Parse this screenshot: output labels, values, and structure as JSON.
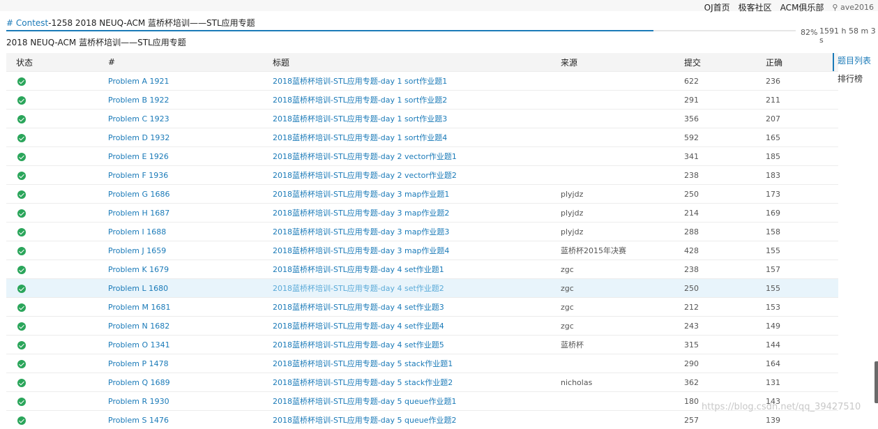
{
  "nav": {
    "items": [
      "OJ首页",
      "极客社区",
      "ACM俱乐部"
    ],
    "user": "ave2016"
  },
  "breadcrumb": {
    "hash": "# Contest",
    "text": "-1258 2018 NEUQ-ACM 蓝桥杯培训——STL应用专题"
  },
  "contest_title": "2018 NEUQ-ACM 蓝桥杯培训——STL应用专题",
  "progress": {
    "percent_label": "82%",
    "fraction": 0.82,
    "remaining": "1591 h 58 m 3 s"
  },
  "table": {
    "headers": {
      "status": "状态",
      "id": "#",
      "title": "标题",
      "source": "来源",
      "submit": "提交",
      "accepted": "正确"
    },
    "rows": [
      {
        "id": "Problem A 1921",
        "title": "2018蓝桥杯培训-STL应用专题-day 1 sort作业题1",
        "source": "",
        "submit": "622",
        "accepted": "236"
      },
      {
        "id": "Problem B 1922",
        "title": "2018蓝桥杯培训-STL应用专题-day 1 sort作业题2",
        "source": "",
        "submit": "291",
        "accepted": "211"
      },
      {
        "id": "Problem C 1923",
        "title": "2018蓝桥杯培训-STL应用专题-day 1 sort作业题3",
        "source": "",
        "submit": "356",
        "accepted": "207"
      },
      {
        "id": "Problem D 1932",
        "title": "2018蓝桥杯培训-STL应用专题-day 1 sort作业题4",
        "source": "",
        "submit": "592",
        "accepted": "165"
      },
      {
        "id": "Problem E 1926",
        "title": "2018蓝桥杯培训-STL应用专题-day 2 vector作业题1",
        "source": "",
        "submit": "341",
        "accepted": "185"
      },
      {
        "id": "Problem F 1936",
        "title": "2018蓝桥杯培训-STL应用专题-day 2 vector作业题2",
        "source": "",
        "submit": "238",
        "accepted": "183"
      },
      {
        "id": "Problem G 1686",
        "title": "2018蓝桥杯培训-STL应用专题-day 3 map作业题1",
        "source": "plyjdz",
        "submit": "250",
        "accepted": "173"
      },
      {
        "id": "Problem H 1687",
        "title": "2018蓝桥杯培训-STL应用专题-day 3 map作业题2",
        "source": "plyjdz",
        "submit": "214",
        "accepted": "169"
      },
      {
        "id": "Problem I 1688",
        "title": "2018蓝桥杯培训-STL应用专题-day 3 map作业题3",
        "source": "plyjdz",
        "submit": "288",
        "accepted": "158"
      },
      {
        "id": "Problem J 1659",
        "title": "2018蓝桥杯培训-STL应用专题-day 3 map作业题4",
        "source": "蓝桥杯2015年决赛",
        "submit": "428",
        "accepted": "155"
      },
      {
        "id": "Problem K 1679",
        "title": "2018蓝桥杯培训-STL应用专题-day 4 set作业题1",
        "source": "zgc",
        "submit": "238",
        "accepted": "157"
      },
      {
        "id": "Problem L 1680",
        "title": "2018蓝桥杯培训-STL应用专题-day 4 set作业题2",
        "source": "zgc",
        "submit": "250",
        "accepted": "155"
      },
      {
        "id": "Problem M 1681",
        "title": "2018蓝桥杯培训-STL应用专题-day 4 set作业题3",
        "source": "zgc",
        "submit": "212",
        "accepted": "153"
      },
      {
        "id": "Problem N 1682",
        "title": "2018蓝桥杯培训-STL应用专题-day 4 set作业题4",
        "source": "zgc",
        "submit": "243",
        "accepted": "149"
      },
      {
        "id": "Problem O 1341",
        "title": "2018蓝桥杯培训-STL应用专题-day 4 set作业题5",
        "source": "蓝桥杯",
        "submit": "315",
        "accepted": "144"
      },
      {
        "id": "Problem P 1478",
        "title": "2018蓝桥杯培训-STL应用专题-day 5 stack作业题1",
        "source": "",
        "submit": "290",
        "accepted": "164"
      },
      {
        "id": "Problem Q 1689",
        "title": "2018蓝桥杯培训-STL应用专题-day 5 stack作业题2",
        "source": "nicholas",
        "submit": "362",
        "accepted": "131"
      },
      {
        "id": "Problem R 1930",
        "title": "2018蓝桥杯培训-STL应用专题-day 5 queue作业题1",
        "source": "",
        "submit": "180",
        "accepted": "143"
      },
      {
        "id": "Problem S 1476",
        "title": "2018蓝桥杯培训-STL应用专题-day 5 queue作业题2",
        "source": "",
        "submit": "257",
        "accepted": "139"
      }
    ]
  },
  "sidebar": {
    "items": [
      "题目列表",
      "排行榜"
    ]
  },
  "watermark": "https://blog.csdn.net/qq_39427510",
  "colors": {
    "accent": "#1a7ab8",
    "success": "#2aa55a",
    "highlight_row": "#e8f4fb"
  }
}
